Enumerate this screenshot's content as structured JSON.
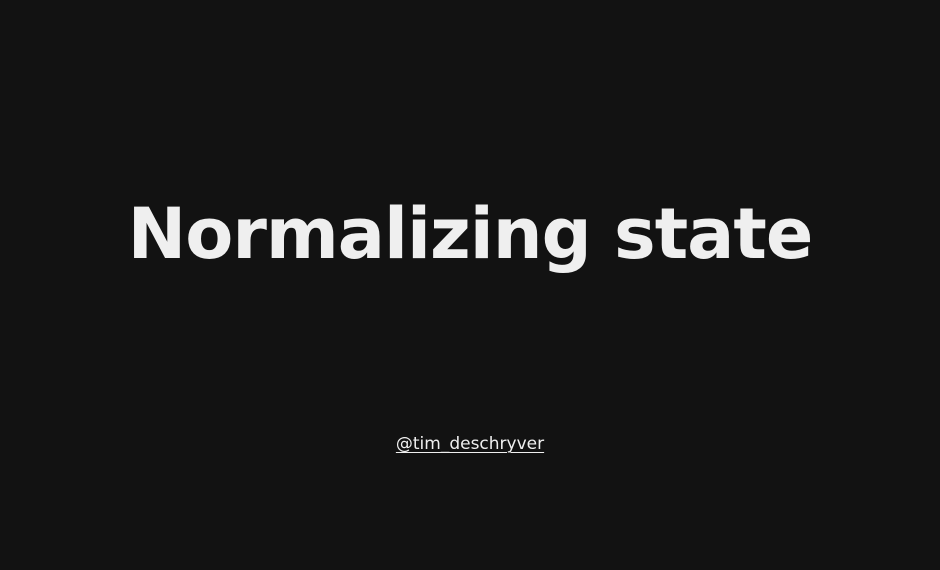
{
  "slide": {
    "title": "Normalizing state",
    "author_handle": "@tim_deschryver"
  },
  "colors": {
    "background": "#121212",
    "text": "#efefef"
  }
}
